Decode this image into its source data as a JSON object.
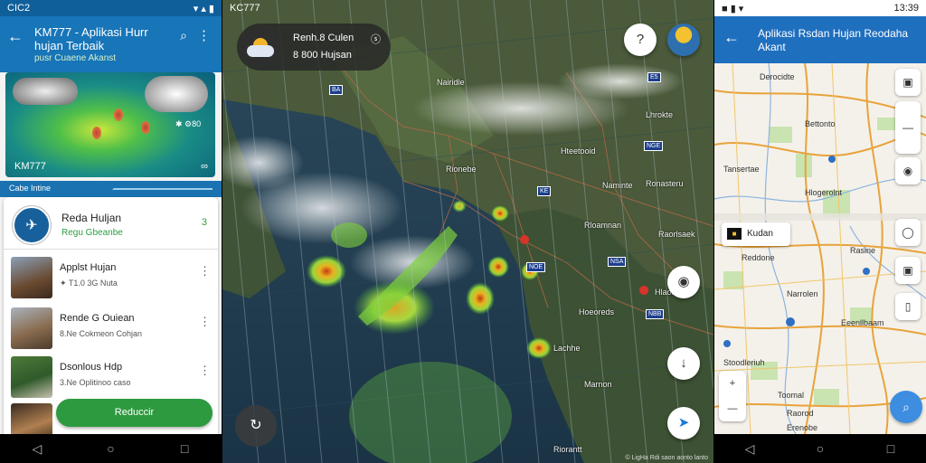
{
  "left": {
    "status_time": "CIC2",
    "status_icons": "▾ ▴ ▮",
    "title": "KM777 - Aplikasi Hurr hujan Terbaik",
    "subtitle": "pusr Cuaene Akanst",
    "hero_label": "KM777",
    "hero_value": "✱ ⚙80",
    "hero_link": "∞",
    "section_label": "Cabe Intine",
    "featured": {
      "logo": "✈",
      "title": "Reda Huljan",
      "subtitle": "Regu Gbeanbe",
      "badge": "3"
    },
    "items": [
      {
        "title": "Applst Hujan",
        "subtitle": "✦ T1.0 3G Nuta",
        "more": "⋮"
      },
      {
        "title": "Rende G Ouiean",
        "subtitle": "8.Ne Cokmeon Cohjan",
        "more": "⋮"
      },
      {
        "title": "Dsonlous Hdp",
        "subtitle": "3.Ne Oplitinoo caso",
        "more": "⋮"
      }
    ],
    "button": "Reduccir",
    "accent": "#1775b8",
    "button_color": "#2e9a3f"
  },
  "center": {
    "status_time": "KC777",
    "weather_card": {
      "title": "Renh.8 Culen",
      "subtitle": "8 800 Hujsan",
      "tag": "ⓢ"
    },
    "buttons": [
      "?",
      "◉",
      "↓",
      "↻"
    ],
    "places": [
      {
        "name": "Nairidle"
      },
      {
        "name": "Lhrokte"
      },
      {
        "name": "Hteetooid"
      },
      {
        "name": "Rionebe"
      },
      {
        "name": "Ronasteru"
      },
      {
        "name": "Rloamnan"
      },
      {
        "name": "Raorlsaek"
      },
      {
        "name": "Hlaotle"
      },
      {
        "name": "Hoeoreds"
      },
      {
        "name": "Lachhe"
      },
      {
        "name": "Marnon"
      },
      {
        "name": "Riorantt"
      },
      {
        "name": "Naminte"
      }
    ],
    "plates": [
      "BA",
      "KE",
      "NOE",
      "NSA",
      "NBB",
      "NGE",
      "E5"
    ],
    "attribution": "© LigHa Rdi saon aonto lanto"
  },
  "right": {
    "status_time": "13:39",
    "status_icons": "■ ▮ ▾",
    "title": "Aplikasi Rsdan Hujan Reodaha Akant",
    "chip": "Kudan",
    "chip_icon": "■",
    "places": [
      {
        "name": "Derocidte"
      },
      {
        "name": "Bettonto"
      },
      {
        "name": "Tansertae"
      },
      {
        "name": "Hlogerolnt"
      },
      {
        "name": "Rasine"
      },
      {
        "name": "Reddone"
      },
      {
        "name": "Narrolen"
      },
      {
        "name": "Eeenllbaam"
      },
      {
        "name": "Stoodleriuh"
      },
      {
        "name": "Toomal"
      },
      {
        "name": "Raorod"
      },
      {
        "name": "Erenobe"
      }
    ],
    "side_buttons": [
      "▣",
      "—",
      "◉",
      "◯",
      "▣",
      "▯"
    ],
    "zoom": [
      "+",
      "—"
    ],
    "fab": "⌕"
  },
  "nav": {
    "back": "◁",
    "home": "○",
    "recent": "□"
  }
}
